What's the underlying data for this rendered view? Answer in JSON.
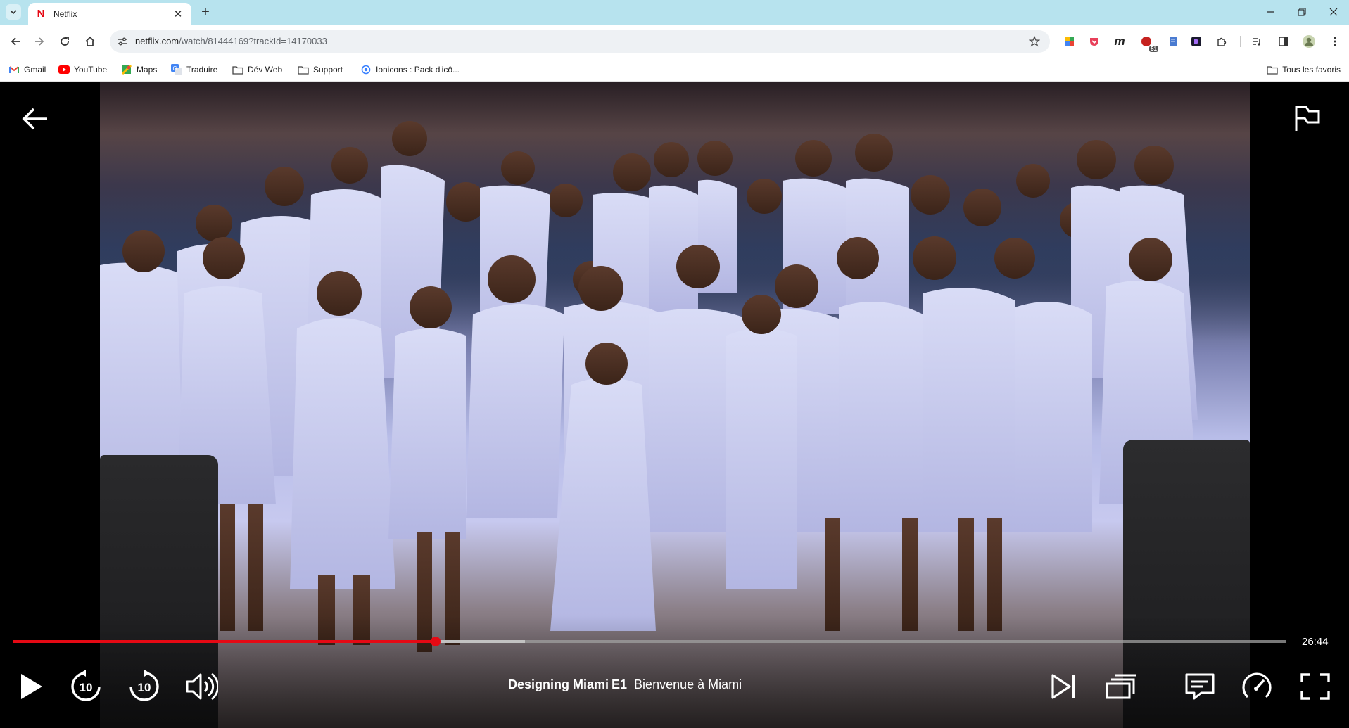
{
  "browser": {
    "tab": {
      "title": "Netflix",
      "favicon": "N"
    },
    "url": {
      "host": "netflix.com",
      "path": "/watch/81444169?trackId=14170033"
    },
    "bookmarks": [
      {
        "label": "Gmail",
        "icon": "gmail-icon"
      },
      {
        "label": "YouTube",
        "icon": "youtube-icon"
      },
      {
        "label": "Maps",
        "icon": "maps-icon"
      },
      {
        "label": "Traduire",
        "icon": "translate-icon"
      },
      {
        "label": "Dév Web",
        "icon": "folder-icon"
      },
      {
        "label": "Support",
        "icon": "folder-icon"
      },
      {
        "label": "Ionicons : Pack d'icô...",
        "icon": "ionicons-icon"
      }
    ],
    "all_bookmarks": "Tous les favoris",
    "extension_badge": "51"
  },
  "player": {
    "show_title": "Designing Miami",
    "episode": "E1",
    "episode_name": "Bienvenue à Miami",
    "time_remaining": "26:44",
    "progress": 0.332,
    "buffered": 0.402,
    "skip_seconds": "10",
    "accent": "#e50914"
  }
}
